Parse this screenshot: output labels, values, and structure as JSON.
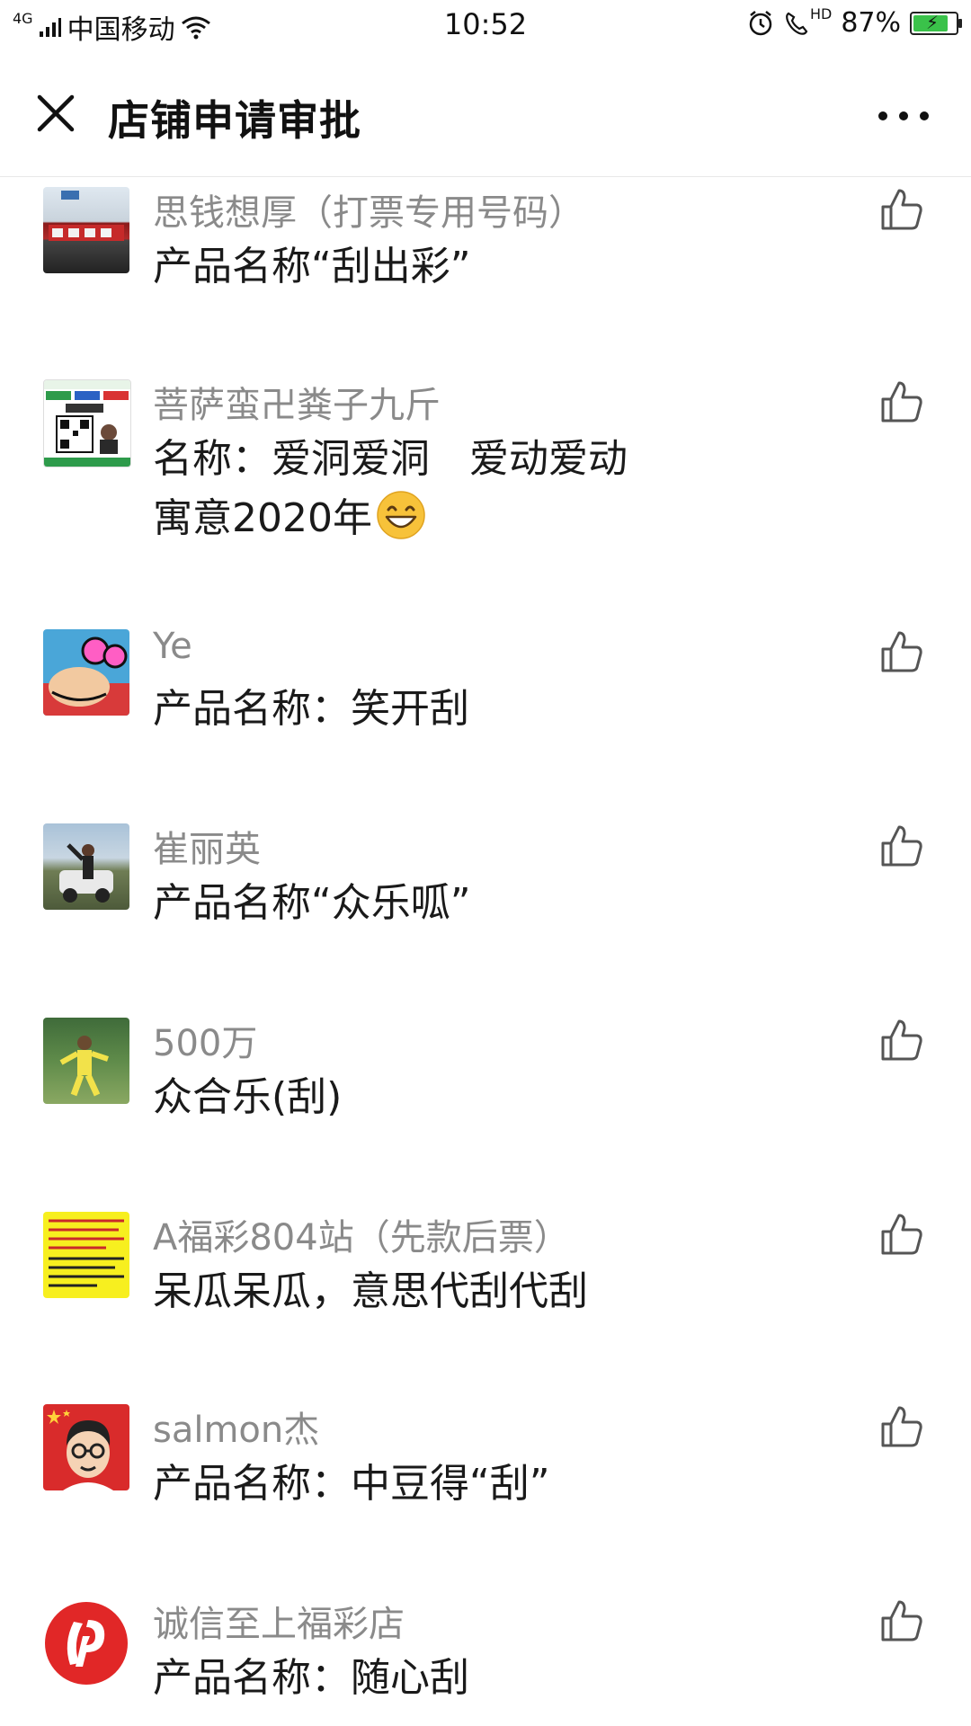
{
  "status_bar": {
    "network": "4G",
    "carrier": "中国移动",
    "time": "10:52",
    "hd": "HD",
    "battery": "87%",
    "battery_level": 0.87
  },
  "header": {
    "title": "店铺申请审批"
  },
  "comments": [
    {
      "name": "思钱想厚（打票专用号码）",
      "lines": [
        "产品名称“刮出彩”"
      ]
    },
    {
      "name": "菩萨蛮卍粪子九斤",
      "lines": [
        "名称：爱洞爱洞　爱动爱动",
        "寓意2020年"
      ]
    },
    {
      "name": "Ye",
      "lines": [
        "产品名称：笑开刮"
      ]
    },
    {
      "name": "崔丽英",
      "lines": [
        "产品名称“众乐呱”"
      ]
    },
    {
      "name": "500万",
      "lines": [
        "众合乐(刮)"
      ]
    },
    {
      "name": "A福彩804站（先款后票）",
      "lines": [
        "呆瓜呆瓜，意思代刮代刮"
      ]
    },
    {
      "name": "salmon杰",
      "lines": [
        "产品名称：中豆得“刮”"
      ]
    },
    {
      "name": "诚信至上福彩店",
      "lines": [
        "产品名称：随心刮"
      ]
    }
  ],
  "icons": {
    "close": "close-icon",
    "more": "more-icon",
    "like": "thumbs-up-icon",
    "emoji": "grinning-face-emoji"
  },
  "colors": {
    "name": "#8a8a8a",
    "content": "#1a1a1a",
    "battery": "#3ac24a"
  }
}
